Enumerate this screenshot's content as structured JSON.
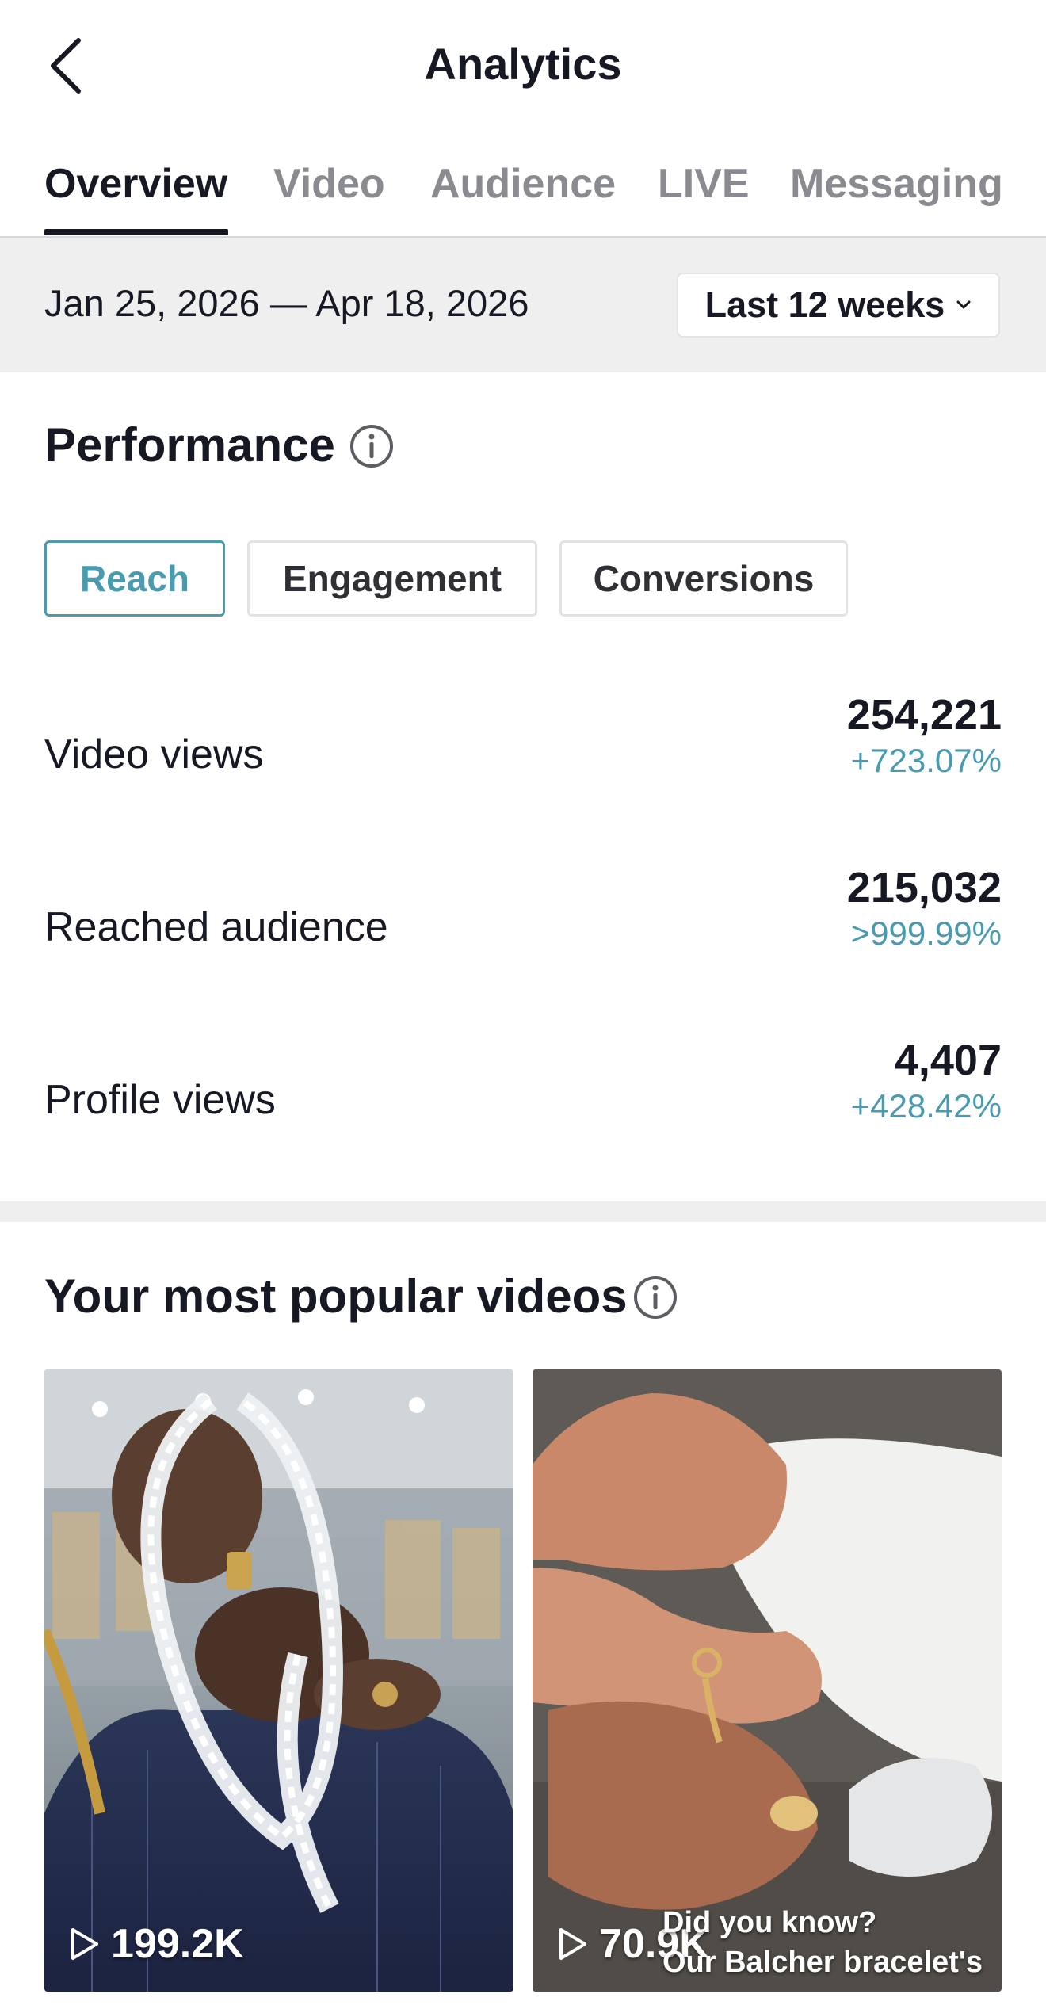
{
  "header": {
    "title": "Analytics",
    "back_icon": "chevron-left-icon"
  },
  "tabs": [
    {
      "label": "Overview",
      "active": true
    },
    {
      "label": "Video",
      "active": false
    },
    {
      "label": "Audience",
      "active": false
    },
    {
      "label": "LIVE",
      "active": false
    },
    {
      "label": "Messaging",
      "active": false
    }
  ],
  "date_bar": {
    "range_text": "Jan 25, 2026 — Apr 18, 2026",
    "selected_period": "Last 12 weeks"
  },
  "performance": {
    "title": "Performance",
    "metric_tabs": [
      {
        "label": "Reach",
        "active": true
      },
      {
        "label": "Engagement",
        "active": false
      },
      {
        "label": "Conversions",
        "active": false
      }
    ],
    "metrics": [
      {
        "label": "Video views",
        "value": "254,221",
        "change": "+723.07%"
      },
      {
        "label": "Reached audience",
        "value": "215,032",
        "change": ">999.99%"
      },
      {
        "label": "Profile views",
        "value": "4,407",
        "change": "+428.42%"
      }
    ]
  },
  "popular_videos": {
    "title": "Your most popular videos",
    "videos": [
      {
        "views": "199.2K",
        "caption": ""
      },
      {
        "views": "70.9K",
        "caption_line1": "Did you know?",
        "caption_line2": "Our Balcher bracelet's"
      }
    ]
  },
  "colors": {
    "accent": "#4a9ab0",
    "text_primary": "#161823",
    "text_secondary": "#8a8b91",
    "band": "#efefef"
  }
}
